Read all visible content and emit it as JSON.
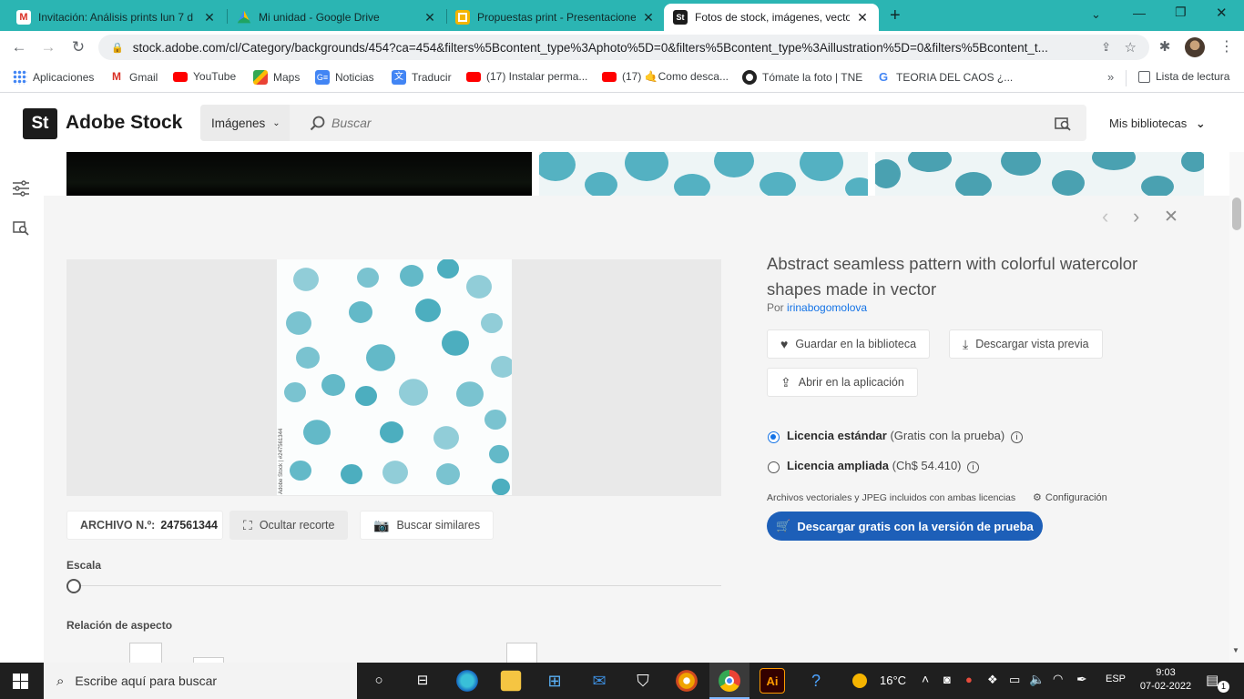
{
  "browser": {
    "tabs": [
      {
        "title": "Invitación: Análisis prints lun 7 d",
        "favicon": "gmail-icon",
        "color": "#d93025"
      },
      {
        "title": "Mi unidad - Google Drive",
        "favicon": "google-drive-icon",
        "color": "#1fa463"
      },
      {
        "title": "Propuestas print - Presentacione",
        "favicon": "google-slides-icon",
        "color": "#f4b400"
      },
      {
        "title": "Fotos de stock, imágenes, vecto",
        "favicon": "adobe-stock-icon",
        "color": "#1b1b1b"
      }
    ],
    "url": "stock.adobe.com/cl/Category/backgrounds/454?ca=454&filters%5Bcontent_type%3Aphoto%5D=0&filters%5Bcontent_type%3Aillustration%5D=0&filters%5Bcontent_t...",
    "bookmarks": [
      {
        "label": "Aplicaciones",
        "icon": "apps-grid-icon",
        "color": "#4285f4"
      },
      {
        "label": "Gmail",
        "icon": "gmail-icon",
        "color": "#d93025"
      },
      {
        "label": "YouTube",
        "icon": "youtube-icon",
        "color": "#ff0000"
      },
      {
        "label": "Maps",
        "icon": "maps-icon",
        "color": "#34a853"
      },
      {
        "label": "Noticias",
        "icon": "news-icon",
        "color": "#4285f4"
      },
      {
        "label": "Traducir",
        "icon": "translate-icon",
        "color": "#4285f4"
      },
      {
        "label": "(17) Instalar perma...",
        "icon": "youtube-icon",
        "color": "#ff0000"
      },
      {
        "label": "(17) 🤙Como desca...",
        "icon": "youtube-icon",
        "color": "#ff0000"
      },
      {
        "label": "Tómate la foto | TNE",
        "icon": "tne-icon",
        "color": "#222222"
      },
      {
        "label": "TEORIA DEL CAOS ¿...",
        "icon": "google-icon",
        "color": "#4285f4"
      }
    ],
    "reading_list": "Lista de lectura"
  },
  "header": {
    "logo_badge": "St",
    "logo_text": "Adobe Stock",
    "type_select": "Imágenes",
    "search_placeholder": "Buscar",
    "libraries": "Mis bibliotecas"
  },
  "asset": {
    "title": "Abstract seamless pattern with colorful watercolor shapes made in vector",
    "by_label": "Por",
    "author": "irinabogomolova",
    "save_label": "Guardar en la biblioteca",
    "preview_label": "Descargar vista previa",
    "open_app_label": "Abrir en la aplicación",
    "license_std": "Licencia estándar",
    "license_std_note": "(Gratis con la prueba)",
    "license_ext": "Licencia ampliada",
    "license_ext_note": "(Ch$ 54.410)",
    "formats_note": "Archivos vectoriales y JPEG incluidos con ambas licencias",
    "config_label": "Configuración",
    "download_label": "Descargar gratis con la versión de prueba",
    "file_label": "ARCHIVO N.º:",
    "file_number": "247561344",
    "hide_crop": "Ocultar recorte",
    "find_similar": "Buscar similares",
    "scale_label": "Escala",
    "aspect_label": "Relación de aspecto",
    "watermark": "Adobe Stock | #247561344"
  },
  "taskbar": {
    "search_placeholder": "Escribe aquí para buscar",
    "temperature": "16°C",
    "language": "ESP",
    "time": "9:03",
    "date": "07-02-2022",
    "notification_count": "1"
  },
  "colors": {
    "tab_strip": "#2bb5b3",
    "accent_blue": "#1473e6",
    "download_button": "#1d5fb8",
    "watercolor": "#3aa6b9"
  }
}
